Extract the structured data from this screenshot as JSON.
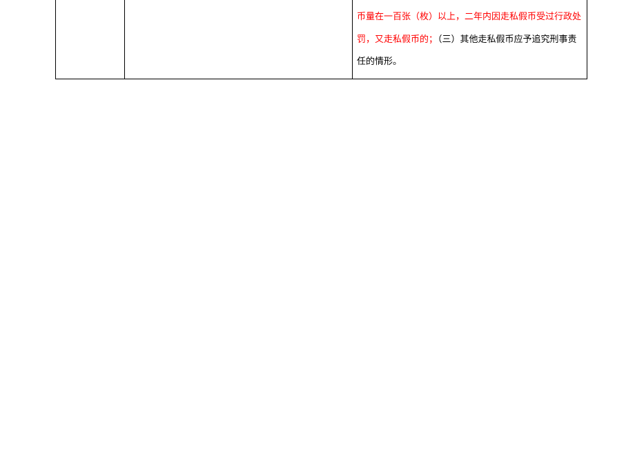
{
  "table": {
    "row": {
      "col1": "",
      "col2": "",
      "col3": {
        "red_part": "币量在一百张（枚）以上，二年内因走私假币受过行政处罚，又走私假币的；",
        "black_part": "（三）其他走私假币应予追究刑事责任的情形。"
      }
    }
  }
}
